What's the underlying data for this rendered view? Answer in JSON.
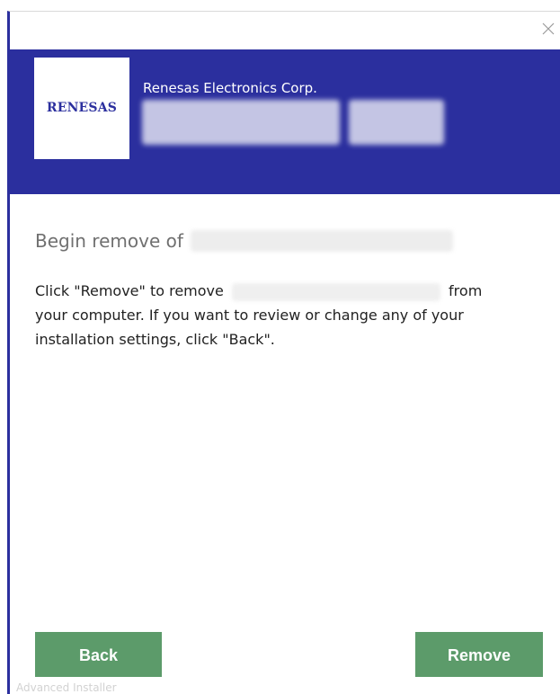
{
  "window": {
    "close_glyph": "×",
    "banner_color": "#2b2f9e"
  },
  "header": {
    "logo_text": "RENESAS",
    "publisher": "Renesas Electronics Corp."
  },
  "content": {
    "heading_prefix": "Begin remove of",
    "message_line1_prefix": "Click \"Remove\" to remove",
    "message_line1_suffix": "from",
    "message_line2": "your computer.  If you want to review or change any of your",
    "message_line3": "installation settings, click \"Back\"."
  },
  "buttons": {
    "back_label": "Back",
    "remove_label": "Remove",
    "button_color": "#5c9b6a"
  },
  "footer": {
    "brand": "Advanced Installer"
  }
}
